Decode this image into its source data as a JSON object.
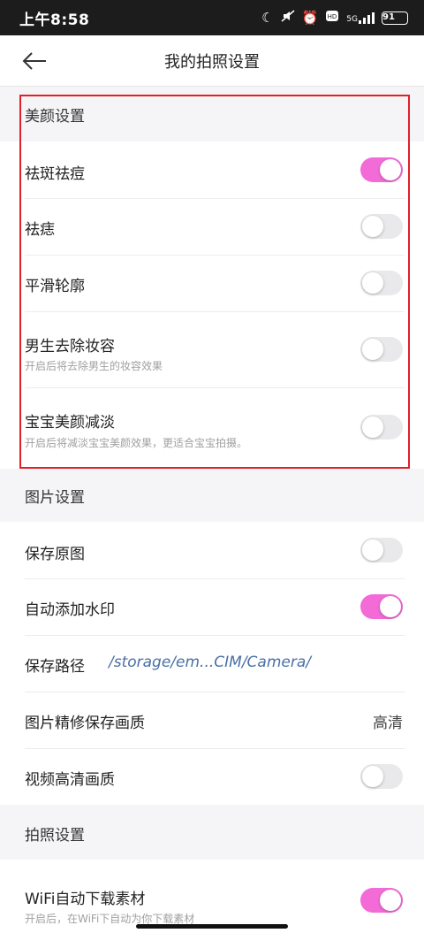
{
  "status_bar": {
    "time": "上午8:58",
    "network": "5G",
    "battery": "91"
  },
  "header": {
    "title": "我的拍照设置"
  },
  "sections": {
    "beauty": {
      "title": "美颜设置",
      "items": [
        {
          "label": "祛斑祛痘",
          "enabled": true
        },
        {
          "label": "祛痣",
          "enabled": false
        },
        {
          "label": "平滑轮廓",
          "enabled": false
        },
        {
          "label": "男生去除妆容",
          "sublabel": "开启后将去除男生的妆容效果",
          "enabled": false
        },
        {
          "label": "宝宝美颜减淡",
          "sublabel": "开启后将减淡宝宝美颜效果，更适合宝宝拍摄。",
          "enabled": false
        }
      ]
    },
    "photo": {
      "title": "图片设置",
      "save_original": {
        "label": "保存原图",
        "enabled": false
      },
      "watermark": {
        "label": "自动添加水印",
        "enabled": true
      },
      "save_path": {
        "label": "保存路径",
        "value": "/storage/em...CIM/Camera/"
      },
      "retouch_quality": {
        "label": "图片精修保存画质",
        "value": "高清"
      },
      "video_hd": {
        "label": "视频高清画质",
        "enabled": false
      }
    },
    "camera": {
      "title": "拍照设置",
      "wifi_download": {
        "label": "WiFi自动下载素材",
        "sublabel": "开启后，在WiFi下自动为你下载素材",
        "enabled": true
      }
    }
  },
  "colors": {
    "toggle_on": "#f26bd6",
    "toggle_off": "#e9e9eb",
    "highlight": "#e0202a",
    "path_link": "#4a6fa5"
  }
}
